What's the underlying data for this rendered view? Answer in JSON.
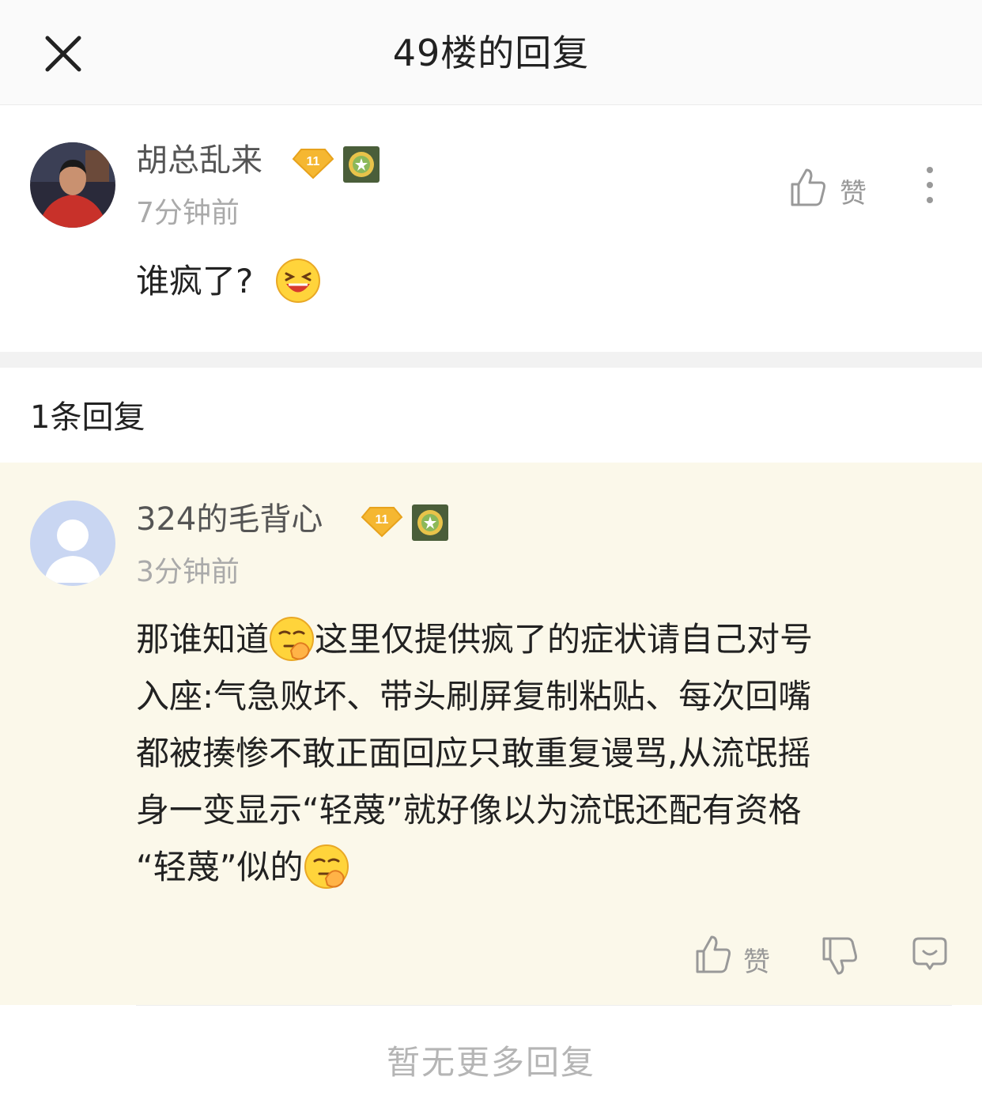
{
  "header": {
    "title": "49楼的回复"
  },
  "main_post": {
    "username": "胡总乱来",
    "level": "11",
    "time": "7分钟前",
    "content": "谁疯了?",
    "like_label": "赞"
  },
  "reply_count": "1条回复",
  "reply": {
    "username": "324的毛背心",
    "level": "11",
    "time": "3分钟前",
    "line1_a": "那谁知道",
    "line1_b": "这里仅提供疯了的症状请自己对号",
    "line2": "入座:气急败坏、带头刷屏复制粘贴、每次回嘴",
    "line3": "都被揍惨不敢正面回应只敢重复谩骂,从流氓摇",
    "line4": "身一变显示“轻蔑”就好像以为流氓还配有资格",
    "line5": "“轻蔑”似的",
    "like_label": "赞"
  },
  "footer": {
    "text": "暂无更多回复"
  },
  "colors": {
    "badge_gold": "#f5b731",
    "medal_green": "#4a5e3a",
    "card_bg": "#fbf8ea"
  }
}
